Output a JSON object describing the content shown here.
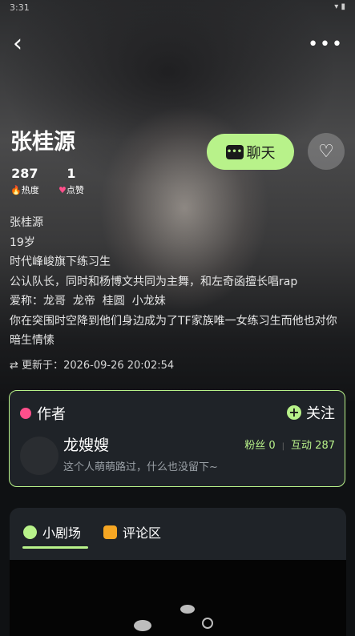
{
  "status": {
    "time": "3:31",
    "icons": "▾ ▮"
  },
  "nav": {
    "back": "‹",
    "more": "•••"
  },
  "profile": {
    "name": "张桂源",
    "heat_value": "287",
    "heat_label": "热度",
    "likes_value": "1",
    "likes_label": "点赞",
    "chat_label": "聊天",
    "like_icon": "♡"
  },
  "description": {
    "line1": "张桂源",
    "line2": "19岁",
    "line3": "时代峰峻旗下练习生",
    "line4": "公认队长，同时和杨博文共同为主舞，和左奇函擅长唱rap",
    "line5": "爱称：龙哥  龙帝  桂圆  小龙妹",
    "line6": "你在突围时空降到他们身边成为了TF家族唯一女练习生而他也对你暗生情愫"
  },
  "updated": {
    "label": "更新于：",
    "time": "2026-09-26 20:02:54"
  },
  "author": {
    "section_title": "作者",
    "follow_label": "关注",
    "name": "龙嫂嫂",
    "bio": "这个人萌萌路过，什么也没留下~",
    "fans": "粉丝 0",
    "interactions": "互动 287"
  },
  "tabs": [
    {
      "label": "小剧场"
    },
    {
      "label": "评论区"
    }
  ],
  "colors": {
    "accent": "#b8f28a",
    "pink": "#ff4f8b",
    "orange": "#f5a623"
  }
}
